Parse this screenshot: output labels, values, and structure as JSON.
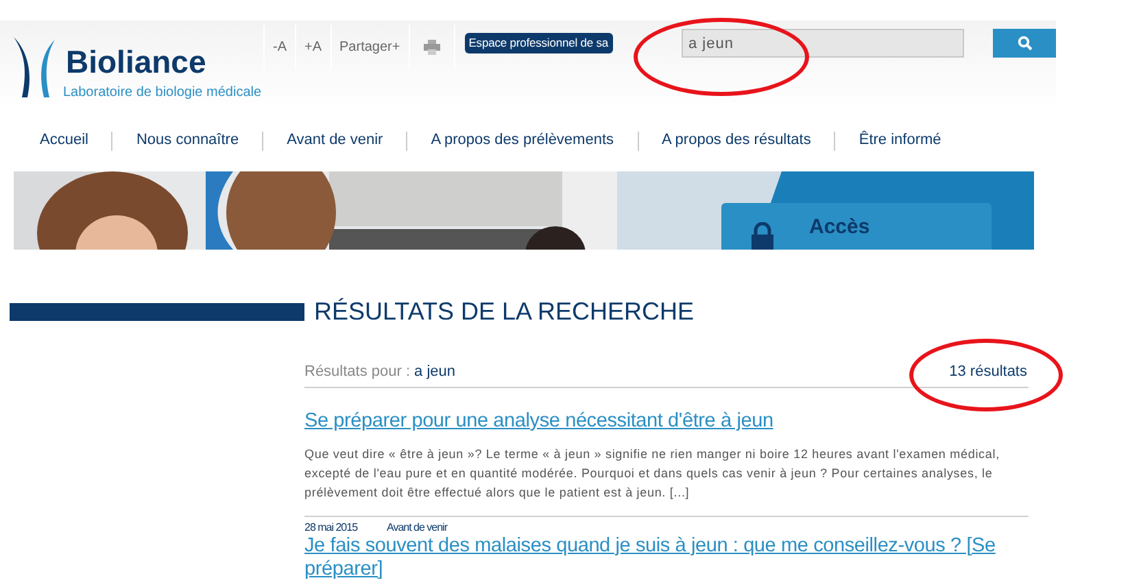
{
  "logo": {
    "name": "Bioliance",
    "tagline": "Laboratoire de biologie médicale"
  },
  "toolbar": [
    {
      "kind": "text",
      "label": "-A"
    },
    {
      "kind": "text",
      "label": "+A"
    },
    {
      "kind": "text",
      "label": "Partager+"
    },
    {
      "kind": "print"
    }
  ],
  "pro_button": "Espace professionnel de sa",
  "search": {
    "value": "a jeun"
  },
  "nav": [
    "Accueil",
    "Nous connaître",
    "Avant de venir",
    "A propos des prélèvements",
    "A propos des résultats",
    "Être informé"
  ],
  "banner": {
    "kind": "picture",
    "card": {
      "title": "Accès"
    }
  },
  "heading": "RÉSULTATS DE LA RECHERCHE",
  "summary": {
    "label": "Résultats pour :",
    "query": "a jeun",
    "count": "13 résultats"
  },
  "results": [
    {
      "title": "Se préparer pour une analyse nécessitant d'être à jeun",
      "excerpt": "Que veut dire « être à jeun »? Le terme « à jeun » signifie ne rien manger ni boire 12 heures avant l'examen médical, excepté de l'eau pure et en quantité modérée. Pourquoi et dans quels cas venir à jeun ? Pour certaines analyses, le prélèvement doit être effectué alors que le patient est à jeun. [...]"
    },
    {
      "date": "28 mai 2015",
      "category": "Avant de venir",
      "title": "Je fais souvent des malaises quand je suis à jeun : que me conseillez-vous ? [Se préparer]"
    }
  ],
  "annotations": [
    {
      "kind": "ellipse",
      "color": "#e8141b"
    },
    {
      "kind": "ellipse",
      "color": "#e8141b"
    }
  ]
}
